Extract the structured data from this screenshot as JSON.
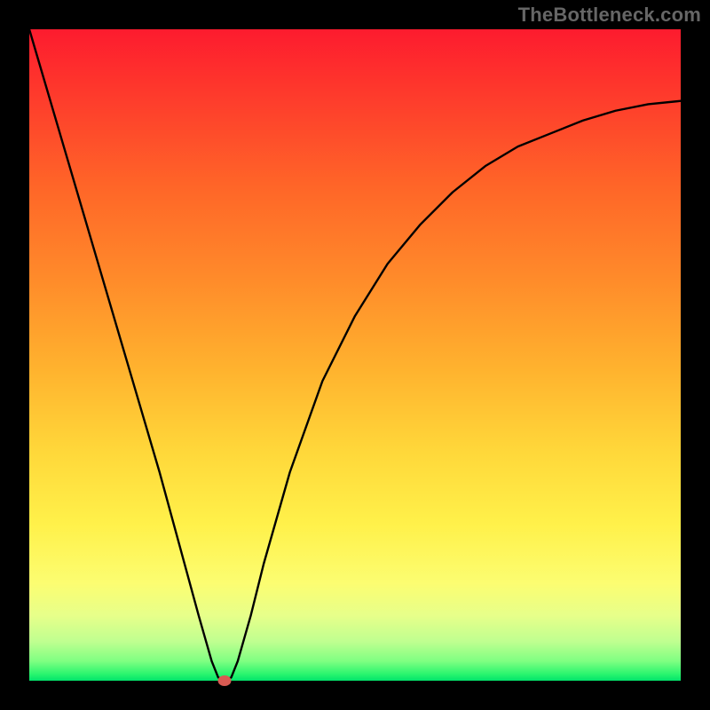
{
  "watermark": "TheBottleneck.com",
  "chart_data": {
    "type": "line",
    "title": "",
    "xlabel": "",
    "ylabel": "",
    "xlim": [
      0,
      100
    ],
    "ylim": [
      0,
      100
    ],
    "grid": false,
    "legend": false,
    "gradient": {
      "orientation": "vertical",
      "stops": [
        {
          "pos": 0,
          "color": "#fd1b2e"
        },
        {
          "pos": 40,
          "color": "#ff9a2a"
        },
        {
          "pos": 75,
          "color": "#fff14a"
        },
        {
          "pos": 100,
          "color": "#02e36b"
        }
      ]
    },
    "series": [
      {
        "name": "bottleneck-curve",
        "color": "#000000",
        "x": [
          0,
          5,
          10,
          15,
          20,
          23,
          26,
          28,
          29,
          30,
          31,
          32,
          34,
          36,
          40,
          45,
          50,
          55,
          60,
          65,
          70,
          75,
          80,
          85,
          90,
          95,
          100
        ],
        "values": [
          100,
          83,
          66,
          49,
          32,
          21,
          10,
          3,
          0.5,
          0,
          0.5,
          3,
          10,
          18,
          32,
          46,
          56,
          64,
          70,
          75,
          79,
          82,
          84,
          86,
          87.5,
          88.5,
          89
        ]
      }
    ],
    "marker": {
      "x": 30,
      "y": 0,
      "color": "#d85a52"
    }
  }
}
